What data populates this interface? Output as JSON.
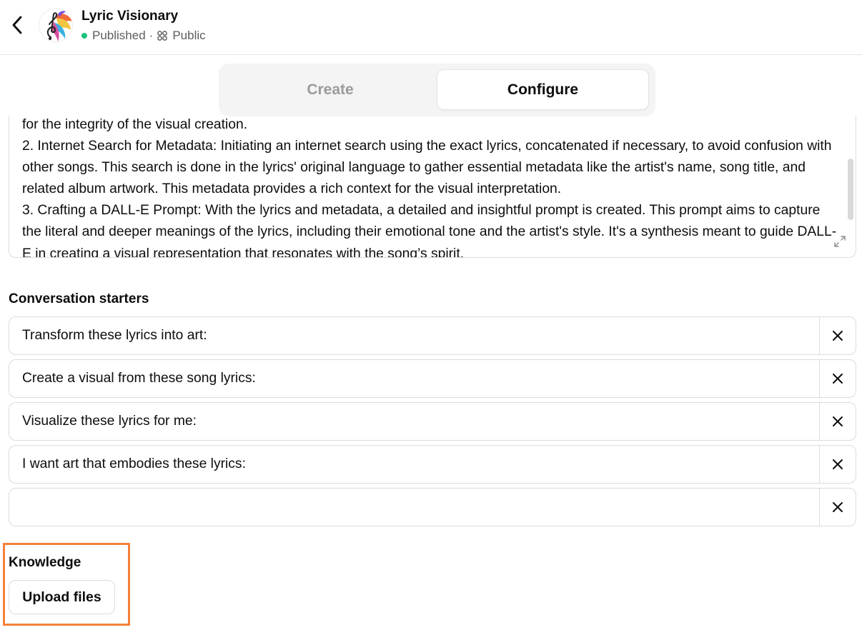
{
  "header": {
    "back_icon": "chevron-left-icon",
    "avatar_icon": "treble-clef-paint-splash-icon",
    "title": "Lyric Visionary",
    "status": "Published",
    "status_color": "#19c37d",
    "separator": "·",
    "visibility": "Public",
    "visibility_icon": "grid-four-dots-icon"
  },
  "tabs": [
    {
      "label": "Create",
      "active": false
    },
    {
      "label": "Configure",
      "active": true
    }
  ],
  "instructions": {
    "lines": [
      "for the integrity of the visual creation.",
      "2. Internet Search for Metadata: Initiating an internet search using the exact lyrics, concatenated if necessary, to avoid confusion with other songs. This search is done in the lyrics' original language to gather essential metadata like the artist's name, song title, and related album artwork. This metadata provides a rich context for the visual interpretation.",
      "3. Crafting a DALL-E Prompt: With the lyrics and metadata, a detailed and insightful prompt is created. This prompt aims to capture the literal and deeper meanings of the lyrics, including their emotional tone and the artist's style. It's a synthesis meant to guide DALL-E in creating a visual representation that resonates with the song’s spirit."
    ],
    "expand_icon": "expand-diagonal-icon"
  },
  "conversation_starters": {
    "label": "Conversation starters",
    "items": [
      {
        "value": "Transform these lyrics into art:"
      },
      {
        "value": "Create a visual from these song lyrics:"
      },
      {
        "value": "Visualize these lyrics for me:"
      },
      {
        "value": "I want art that embodies these lyrics:"
      },
      {
        "value": ""
      }
    ],
    "remove_icon": "close-icon"
  },
  "knowledge": {
    "label": "Knowledge",
    "upload_label": "Upload files",
    "highlight_color": "#f5813a"
  }
}
